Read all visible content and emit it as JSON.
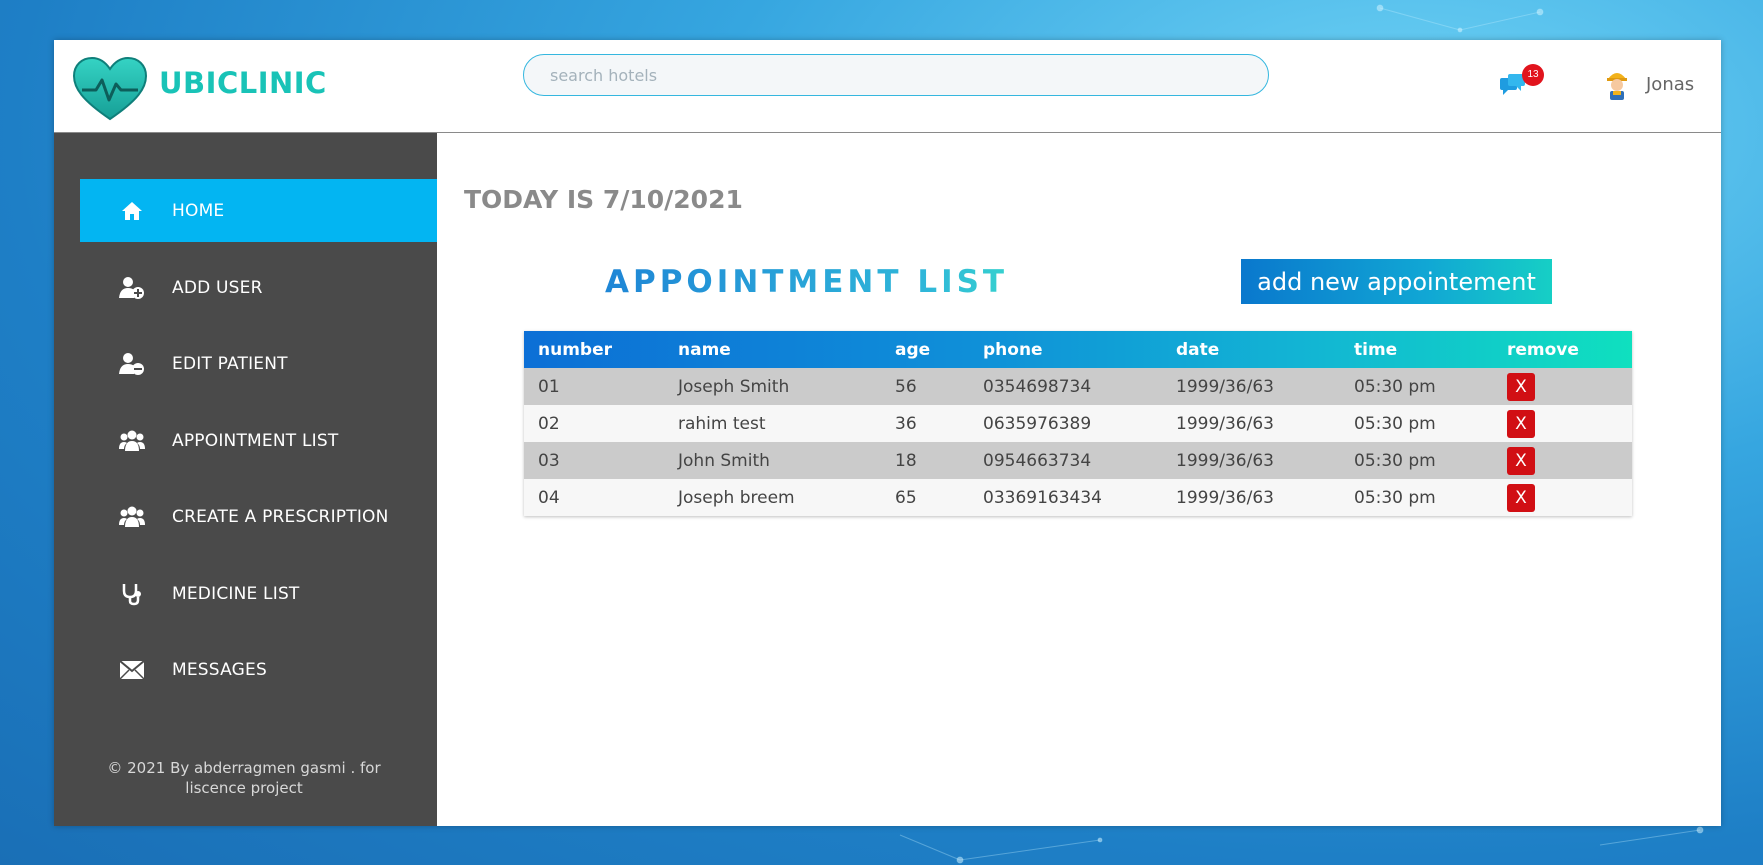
{
  "header": {
    "brand": "UBICLINIC",
    "search_placeholder": "search hotels",
    "message_count": "13",
    "user_name": "Jonas"
  },
  "sidebar": {
    "items": [
      {
        "label": "HOME",
        "icon": "home-icon",
        "active": true
      },
      {
        "label": "ADD USER",
        "icon": "user-plus-icon"
      },
      {
        "label": "EDIT PATIENT",
        "icon": "user-minus-icon"
      },
      {
        "label": "APPOINTMENT LIST",
        "icon": "users-icon"
      },
      {
        "label": "CREATE A PRESCRIPTION",
        "icon": "users-icon"
      },
      {
        "label": "MEDICINE LIST",
        "icon": "stethoscope-icon"
      },
      {
        "label": "MESSAGES",
        "icon": "envelope-icon"
      }
    ],
    "footer_line1": "© 2021 By abderragmen gasmi . for",
    "footer_line2": "liscence project"
  },
  "main": {
    "today": "TODAY IS 7/10/2021",
    "list_title": "APPOINTMENT LIST",
    "add_button": "add new appointement",
    "columns": [
      "number",
      "name",
      "age",
      "phone",
      "date",
      "time",
      "remove"
    ],
    "rows": [
      {
        "number": "01",
        "name": "Joseph Smith",
        "age": "56",
        "phone": "0354698734",
        "date": "1999/36/63",
        "time": "05:30 pm",
        "remove": "X"
      },
      {
        "number": "02",
        "name": "rahim test",
        "age": "36",
        "phone": "0635976389",
        "date": "1999/36/63",
        "time": "05:30 pm",
        "remove": "X"
      },
      {
        "number": "03",
        "name": "John Smith",
        "age": "18",
        "phone": "0954663734",
        "date": "1999/36/63",
        "time": "05:30 pm",
        "remove": "X"
      },
      {
        "number": "04",
        "name": "Joseph breem",
        "age": "65",
        "phone": "03369163434",
        "date": "1999/36/63",
        "time": "05:30 pm",
        "remove": "X"
      }
    ]
  },
  "colors": {
    "accent": "#03b5f2",
    "sidebar_bg": "#4a4a4a",
    "brand": "#19c3b7",
    "remove": "#d10f14",
    "badge": "#e1141d"
  }
}
